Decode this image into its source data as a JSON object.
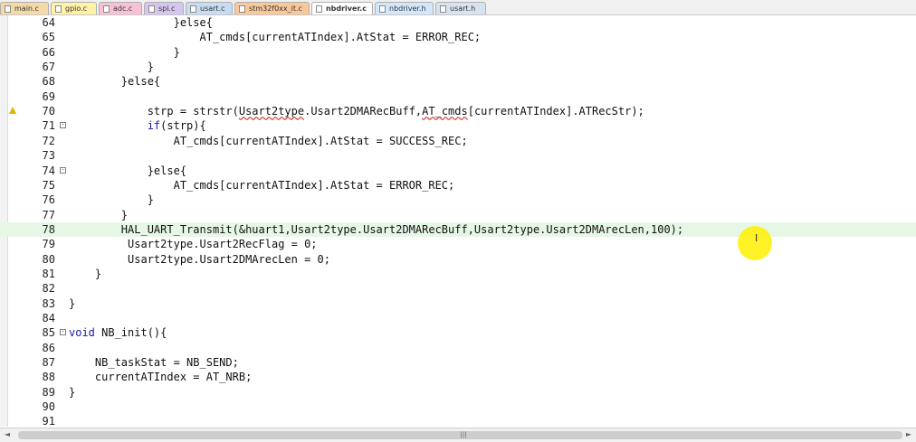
{
  "tabs": [
    {
      "label": "main.c",
      "color": "#f5d9a6",
      "active": false
    },
    {
      "label": "gpio.c",
      "color": "#fff1a8",
      "active": false
    },
    {
      "label": "adc.c",
      "color": "#f7c1d6",
      "active": false
    },
    {
      "label": "spi.c",
      "color": "#d5c6f0",
      "active": false
    },
    {
      "label": "usart.c",
      "color": "#c7dcf2",
      "active": false
    },
    {
      "label": "stm32f0xx_it.c",
      "color": "#f7c89a",
      "active": false
    },
    {
      "label": "nbdriver.c",
      "color": "#ffffff",
      "active": true
    },
    {
      "label": "nbdriver.h",
      "color": "#d2e7fa",
      "active": false
    },
    {
      "label": "usart.h",
      "color": "#d8e3f1",
      "active": false
    }
  ],
  "lines": [
    {
      "num": "64",
      "text": "                }else{"
    },
    {
      "num": "65",
      "text": "                    AT_cmds[currentATIndex].AtStat = ERROR_REC;"
    },
    {
      "num": "66",
      "text": "                }"
    },
    {
      "num": "67",
      "text": "            }"
    },
    {
      "num": "68",
      "text": "        }else{"
    },
    {
      "num": "69",
      "text": ""
    },
    {
      "num": "70",
      "text": "            strp = strstr(Usart2type.Usart2DMARecBuff,AT_cmds[currentATIndex].ATRecStr);"
    },
    {
      "num": "71",
      "text": "            if(strp){"
    },
    {
      "num": "72",
      "text": "                AT_cmds[currentATIndex].AtStat = SUCCESS_REC;"
    },
    {
      "num": "73",
      "text": ""
    },
    {
      "num": "74",
      "text": "            }else{"
    },
    {
      "num": "75",
      "text": "                AT_cmds[currentATIndex].AtStat = ERROR_REC;"
    },
    {
      "num": "76",
      "text": "            }"
    },
    {
      "num": "77",
      "text": "        }"
    },
    {
      "num": "78",
      "text": "        HAL_UART_Transmit(&huart1,Usart2type.Usart2DMARecBuff,Usart2type.Usart2DMArecLen,100);"
    },
    {
      "num": "79",
      "text": "         Usart2type.Usart2RecFlag = 0;"
    },
    {
      "num": "80",
      "text": "         Usart2type.Usart2DMArecLen = 0;"
    },
    {
      "num": "81",
      "text": "    }"
    },
    {
      "num": "82",
      "text": ""
    },
    {
      "num": "83",
      "text": "}"
    },
    {
      "num": "84",
      "text": ""
    },
    {
      "num": "85",
      "text": "void NB_init(){"
    },
    {
      "num": "86",
      "text": ""
    },
    {
      "num": "87",
      "text": "    NB_taskStat = NB_SEND;"
    },
    {
      "num": "88",
      "text": "    currentATIndex = AT_NRB;"
    },
    {
      "num": "89",
      "text": "}"
    },
    {
      "num": "90",
      "text": ""
    },
    {
      "num": "91",
      "text": ""
    }
  ],
  "folds": {
    "71": "-",
    "74": "-",
    "85": "-"
  },
  "highlight_line": "78",
  "warning_line": "70",
  "scrollbar": {
    "left_arrow": "◄",
    "right_arrow": "►",
    "grip": "|||"
  },
  "colors": {
    "keyword": "#1a1aa6",
    "highlight": "#e6f7e6",
    "cursor": "#fff000"
  }
}
